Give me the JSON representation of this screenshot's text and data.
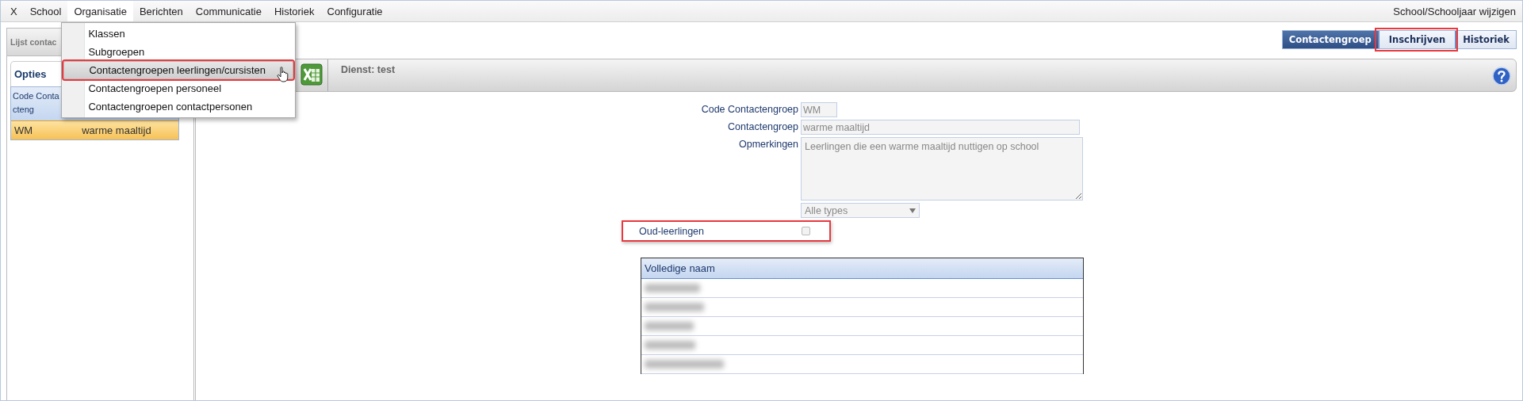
{
  "menubar": {
    "items": [
      {
        "label": "X",
        "selected": false
      },
      {
        "label": "School",
        "selected": false
      },
      {
        "label": "Organisatie",
        "selected": true
      },
      {
        "label": "Berichten",
        "selected": false
      },
      {
        "label": "Communicatie",
        "selected": false
      },
      {
        "label": "Historiek",
        "selected": false
      },
      {
        "label": "Configuratie",
        "selected": false
      }
    ],
    "right_link": "School/Schooljaar wijzigen"
  },
  "dropdown": {
    "items": [
      {
        "label": "Klassen",
        "hovered": false,
        "highlighted": false
      },
      {
        "label": "Subgroepen",
        "hovered": false,
        "highlighted": false
      },
      {
        "label": "Contactengroepen leerlingen/cursisten",
        "hovered": true,
        "highlighted": true
      },
      {
        "label": "Contactengroepen personeel",
        "hovered": false,
        "highlighted": false
      },
      {
        "label": "Contactengroepen contactpersonen",
        "hovered": false,
        "highlighted": false
      }
    ]
  },
  "left_panel": {
    "title": "Lijst contac",
    "tab": "Opties",
    "column": "Code Contacteng",
    "rows": [
      {
        "code": "WM",
        "name": "warme maaltijd",
        "selected": true
      }
    ]
  },
  "view_tabs": [
    {
      "label": "Contactengroep",
      "selected": true,
      "highlighted": false
    },
    {
      "label": "Inschrijven",
      "selected": false,
      "highlighted": true
    },
    {
      "label": "Historiek",
      "selected": false,
      "highlighted": false
    }
  ],
  "toolbar": {
    "service": "Dienst: test"
  },
  "form": {
    "fields": [
      {
        "kind": "short",
        "label": "Code Contactengroep",
        "value": "WM"
      },
      {
        "kind": "wide",
        "label": "Contactengroep",
        "value": "warme maaltijd"
      },
      {
        "kind": "area",
        "label": "Opmerkingen",
        "value": "Leerlingen die een warme maaltijd nuttigen op school"
      },
      {
        "kind": "select",
        "value": "Alle types"
      }
    ],
    "former_students": {
      "label": "Oud-leerlingen",
      "checked": false,
      "highlighted": true
    }
  },
  "members_table": {
    "column": "Volledige naam",
    "rows": [
      {
        "redacted": true
      },
      {
        "redacted": true
      },
      {
        "redacted": true
      },
      {
        "redacted": true
      },
      {
        "redacted": true
      }
    ]
  }
}
